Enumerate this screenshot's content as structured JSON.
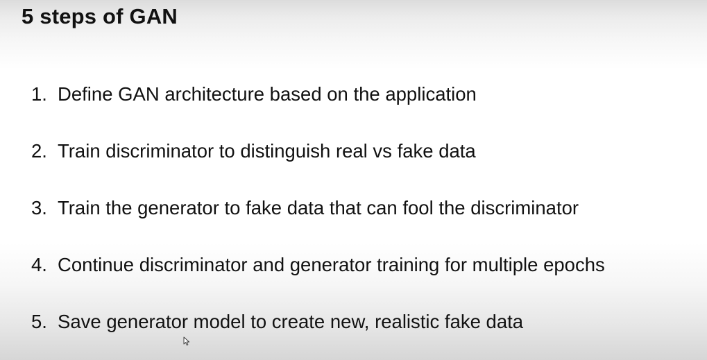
{
  "slide": {
    "title": "5 steps of GAN",
    "steps": [
      {
        "number": "1.",
        "text": "Define GAN architecture based on the application"
      },
      {
        "number": "2.",
        "text": "Train discriminator to distinguish real vs fake data"
      },
      {
        "number": "3.",
        "text": "Train the generator to fake data that can fool the discriminator"
      },
      {
        "number": "4.",
        "text": "Continue discriminator and generator training for multiple epochs"
      },
      {
        "number": "5.",
        "text": "Save generator model to create new, realistic fake data"
      }
    ]
  },
  "cursor_icon": "mouse-pointer-icon"
}
